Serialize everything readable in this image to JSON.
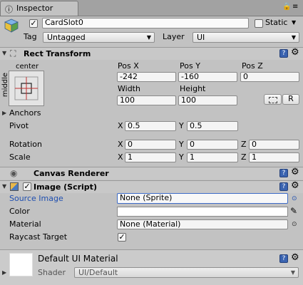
{
  "tab": {
    "title": "Inspector",
    "tab_icon": "info-icon",
    "lock_icon": "lock-icon",
    "menu_icon": "menu-icon"
  },
  "object": {
    "name": "CardSlot0",
    "active": true,
    "static_label": "Static",
    "static": false,
    "tag_label": "Tag",
    "tag_value": "Untagged",
    "layer_label": "Layer",
    "layer_value": "UI"
  },
  "rect_transform": {
    "title": "Rect Transform",
    "anchor_preset_top": "center",
    "anchor_preset_side": "middle",
    "pos_x_label": "Pos X",
    "pos_y_label": "Pos Y",
    "pos_z_label": "Pos Z",
    "pos_x": "-242",
    "pos_y": "-160",
    "pos_z": "0",
    "width_label": "Width",
    "height_label": "Height",
    "width": "100",
    "height": "100",
    "raw_edit_label": "R",
    "anchors_label": "Anchors",
    "pivot_label": "Pivot",
    "pivot_x": "0.5",
    "pivot_y": "0.5",
    "rotation_label": "Rotation",
    "rot_x": "0",
    "rot_y": "0",
    "rot_z": "0",
    "scale_label": "Scale",
    "scale_x": "1",
    "scale_y": "1",
    "scale_z": "1",
    "x_label": "X",
    "y_label": "Y",
    "z_label": "Z"
  },
  "canvas_renderer": {
    "title": "Canvas Renderer"
  },
  "image": {
    "title": "Image (Script)",
    "enabled": true,
    "source_image_label": "Source Image",
    "source_image_value": "None (Sprite)",
    "color_label": "Color",
    "color_value": "#ffffff",
    "material_label": "Material",
    "material_value": "None (Material)",
    "raycast_label": "Raycast Target",
    "raycast": true
  },
  "material_preview": {
    "title": "Default UI Material",
    "shader_label": "Shader",
    "shader_value": "UI/Default"
  },
  "help_text": "?",
  "gear_text": "⚙",
  "check_text": "✓"
}
